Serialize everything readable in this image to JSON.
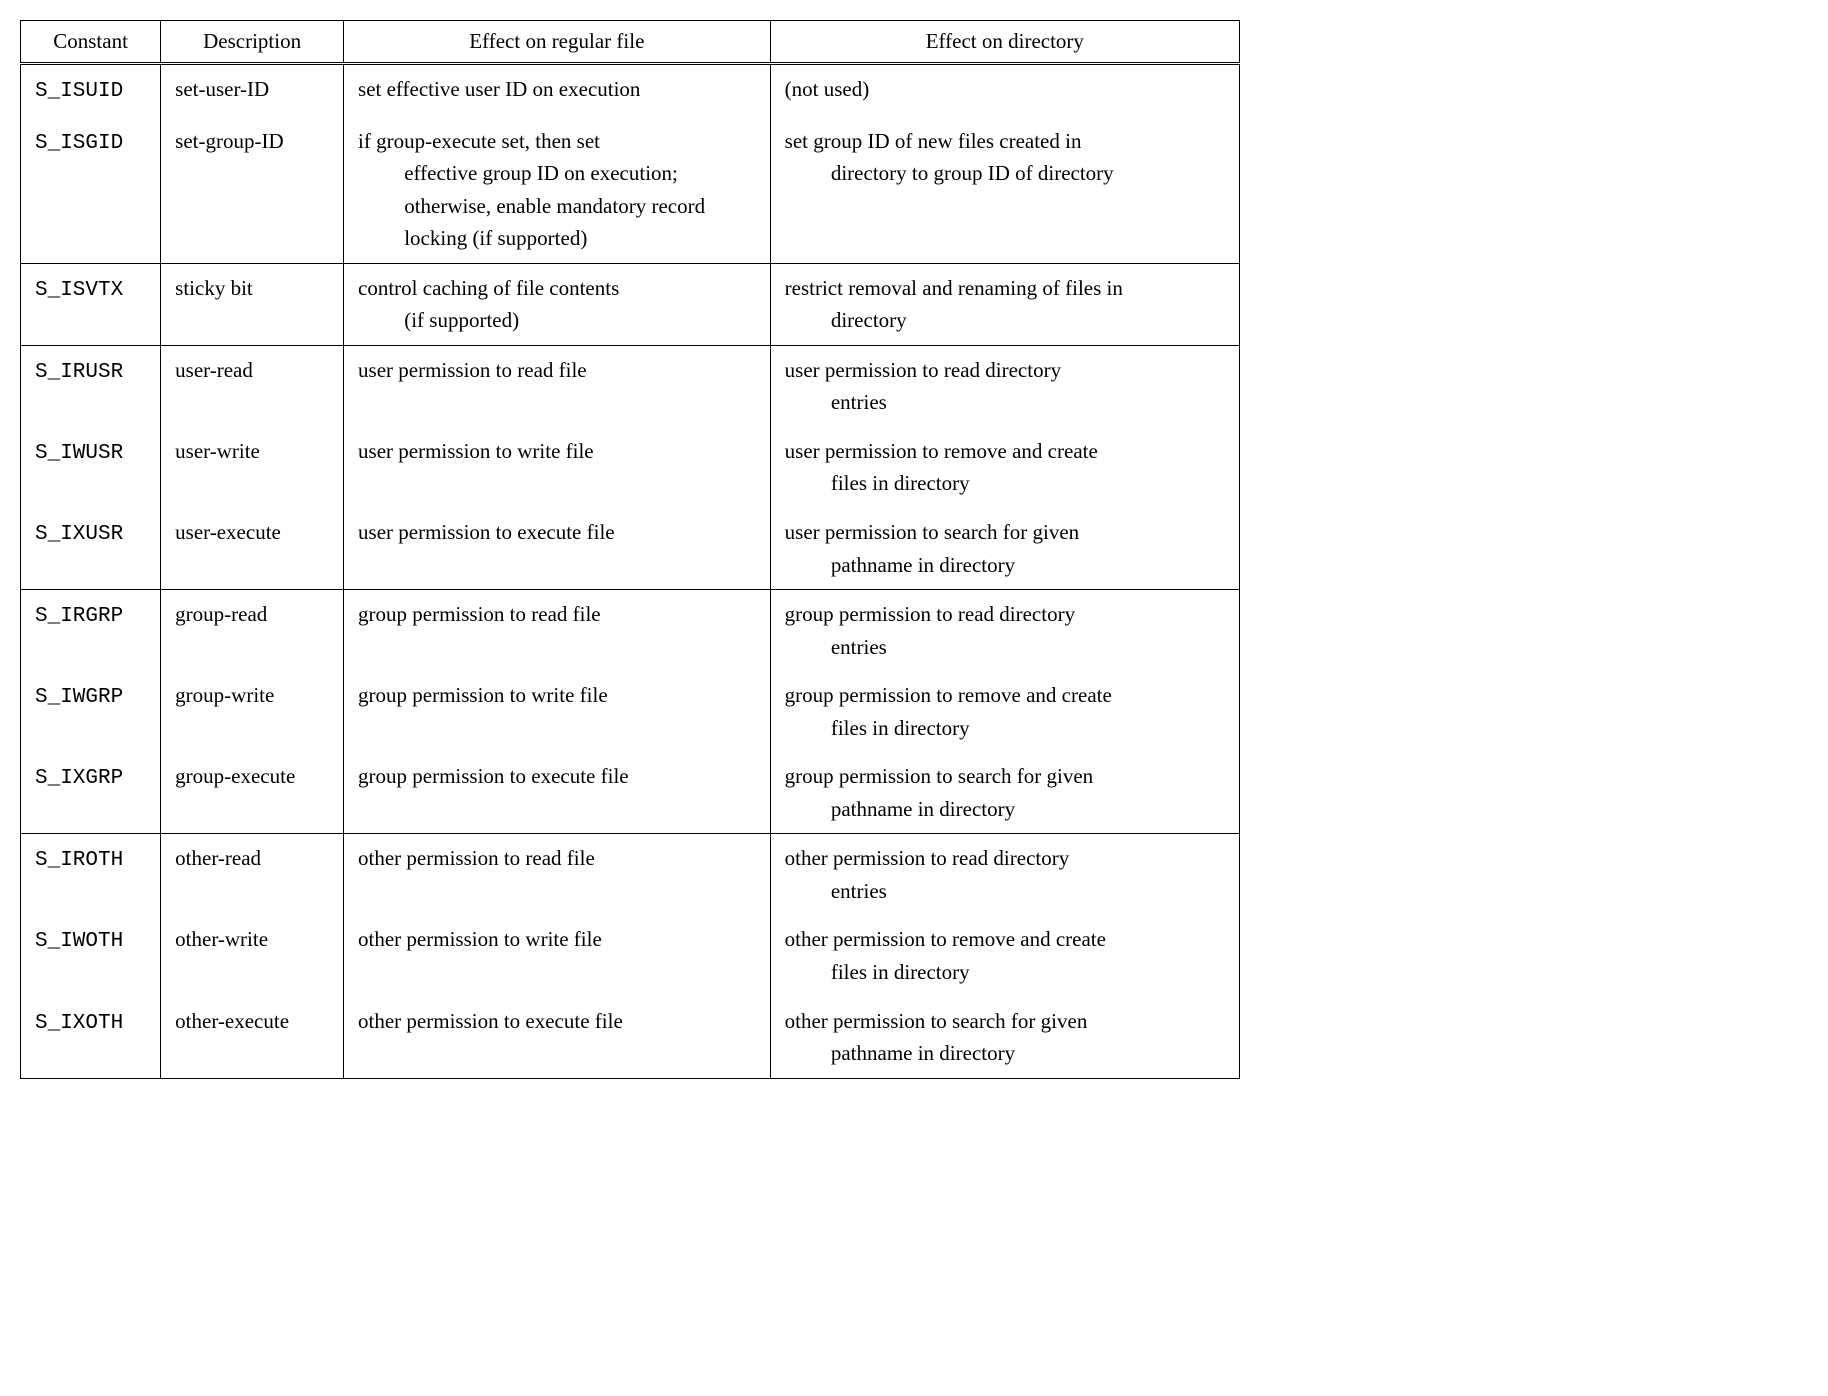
{
  "headers": {
    "constant": "Constant",
    "description": "Description",
    "effect_file": "Effect on regular file",
    "effect_dir": "Effect on directory"
  },
  "rows": [
    {
      "constant": "S_ISUID",
      "description": "set-user-ID",
      "effect_file": "set effective user ID on execution",
      "effect_dir": "(not used)",
      "group_start": true
    },
    {
      "constant": "S_ISGID",
      "description": "set-group-ID",
      "effect_file": "if group-execute set, then set",
      "effect_file_cont": "effective group ID on execution; otherwise, enable mandatory record locking (if supported)",
      "effect_dir": "set group ID of new files created in",
      "effect_dir_cont": "directory to group ID of directory",
      "group_end": true
    },
    {
      "constant": "S_ISVTX",
      "description": "sticky bit",
      "effect_file": "control caching of file contents",
      "effect_file_cont": "(if supported)",
      "effect_dir": "restrict removal and renaming of files in",
      "effect_dir_cont": "directory",
      "group_end": true
    },
    {
      "constant": "S_IRUSR",
      "description": "user-read",
      "effect_file": "user permission to read file",
      "effect_dir": "user permission to read directory",
      "effect_dir_cont": "entries"
    },
    {
      "constant": "S_IWUSR",
      "description": "user-write",
      "effect_file": "user permission to write file",
      "effect_dir": "user permission to remove and create",
      "effect_dir_cont": "files in directory"
    },
    {
      "constant": "S_IXUSR",
      "description": "user-execute",
      "effect_file": "user permission to execute file",
      "effect_dir": "user permission to search for given",
      "effect_dir_cont": "pathname in directory",
      "group_end": true
    },
    {
      "constant": "S_IRGRP",
      "description": "group-read",
      "effect_file": "group permission to read file",
      "effect_dir": "group permission to read directory",
      "effect_dir_cont": "entries"
    },
    {
      "constant": "S_IWGRP",
      "description": "group-write",
      "effect_file": "group permission to write file",
      "effect_dir": "group permission to remove and create",
      "effect_dir_cont": "files in directory"
    },
    {
      "constant": "S_IXGRP",
      "description": "group-execute",
      "effect_file": "group permission to execute file",
      "effect_dir": "group permission to search for given",
      "effect_dir_cont": "pathname in directory",
      "group_end": true
    },
    {
      "constant": "S_IROTH",
      "description": "other-read",
      "effect_file": "other permission to read file",
      "effect_dir": "other permission to read directory",
      "effect_dir_cont": "entries"
    },
    {
      "constant": "S_IWOTH",
      "description": "other-write",
      "effect_file": "other permission to write file",
      "effect_dir": "other permission to remove and create",
      "effect_dir_cont": "files in directory"
    },
    {
      "constant": "S_IXOTH",
      "description": "other-execute",
      "effect_file": "other permission to execute file",
      "effect_dir": "other permission to search for given",
      "effect_dir_cont": "pathname in directory"
    }
  ]
}
